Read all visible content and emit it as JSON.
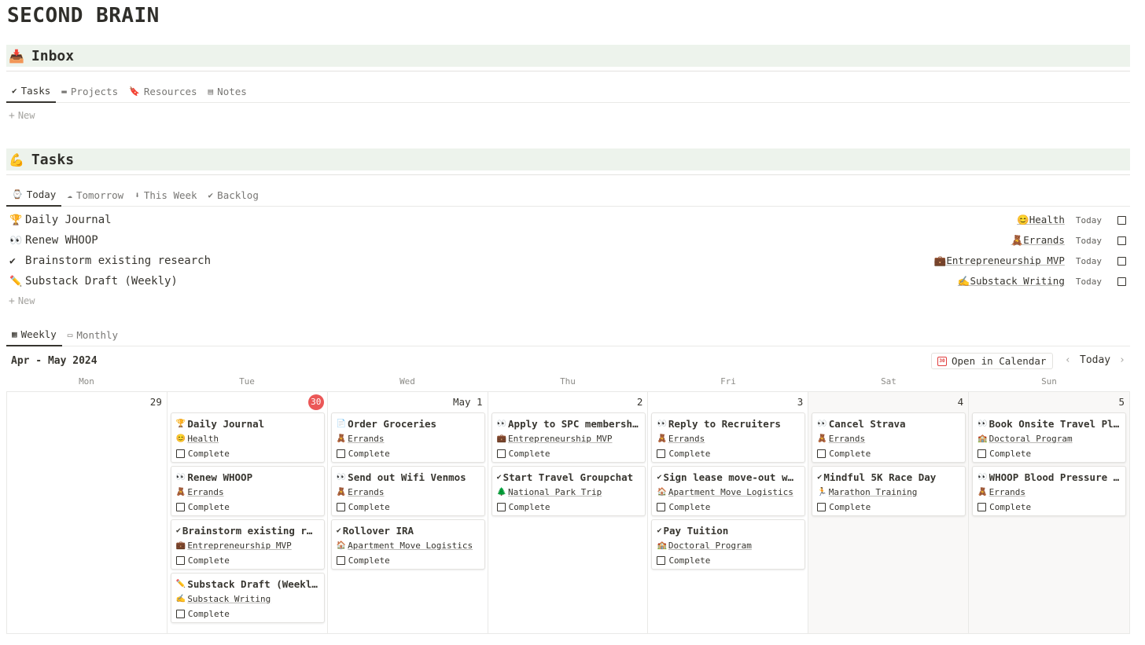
{
  "page": {
    "title": "SECOND BRAIN"
  },
  "inbox": {
    "emoji": "📥",
    "title": "Inbox",
    "tabs": [
      {
        "icon": "✔",
        "label": "Tasks"
      },
      {
        "icon": "▬",
        "label": "Projects"
      },
      {
        "icon": "🔖",
        "label": "Resources"
      },
      {
        "icon": "▤",
        "label": "Notes"
      }
    ],
    "new_label": "New"
  },
  "tasks": {
    "emoji": "💪",
    "title": "Tasks",
    "tabs": [
      {
        "icon": "⌚",
        "label": "Today"
      },
      {
        "icon": "☁",
        "label": "Tomorrow"
      },
      {
        "icon": "⬇",
        "label": "This Week"
      },
      {
        "icon": "✔",
        "label": "Backlog"
      }
    ],
    "rows": [
      {
        "icon": "🏆",
        "name": "Daily Journal",
        "project_icon": "😊",
        "project": "Health",
        "date": "Today"
      },
      {
        "icon": "👀",
        "name": "Renew WHOOP",
        "project_icon": "🧸",
        "project": "Errands",
        "date": "Today"
      },
      {
        "icon": "✔",
        "name": "Brainstorm existing research",
        "project_icon": "💼",
        "project": "Entrepreneurship MVP",
        "date": "Today"
      },
      {
        "icon": "✏️",
        "name": "Substack Draft (Weekly)",
        "project_icon": "✍️",
        "project": "Substack Writing",
        "date": "Today"
      }
    ],
    "new_label": "New"
  },
  "calendar": {
    "tabs": [
      {
        "icon": "▦",
        "label": "Weekly"
      },
      {
        "icon": "▭",
        "label": "Monthly"
      }
    ],
    "range": "Apr - May 2024",
    "open_label": "Open in Calendar",
    "open_icon_text": "30",
    "today_label": "Today",
    "prev_icon": "‹",
    "next_icon": "›",
    "complete_label": "Complete",
    "days": [
      {
        "dow": "Mon",
        "num": "29",
        "today": false,
        "cards": []
      },
      {
        "dow": "Tue",
        "num": "30",
        "today": true,
        "cards": [
          {
            "icon": "🏆",
            "title": "Daily Journal",
            "project_icon": "😊",
            "project": "Health"
          },
          {
            "icon": "👀",
            "title": "Renew WHOOP",
            "project_icon": "🧸",
            "project": "Errands"
          },
          {
            "icon": "✔",
            "title": "Brainstorm existing r…",
            "project_icon": "💼",
            "project": "Entrepreneurship MVP"
          },
          {
            "icon": "✏️",
            "title": "Substack Draft (Weekl…",
            "project_icon": "✍️",
            "project": "Substack Writing"
          }
        ]
      },
      {
        "dow": "Wed",
        "num": "May 1",
        "today": false,
        "cards": [
          {
            "icon": "📄",
            "title": "Order Groceries",
            "project_icon": "🧸",
            "project": "Errands"
          },
          {
            "icon": "👀",
            "title": "Send out Wifi Venmos",
            "project_icon": "🧸",
            "project": "Errands"
          },
          {
            "icon": "✔",
            "title": "Rollover IRA",
            "project_icon": "🏠",
            "project": "Apartment Move Logistics"
          }
        ]
      },
      {
        "dow": "Thu",
        "num": "2",
        "today": false,
        "cards": [
          {
            "icon": "👀",
            "title": "Apply to SPC membersh…",
            "project_icon": "💼",
            "project": "Entrepreneurship MVP"
          },
          {
            "icon": "✔",
            "title": "Start Travel Groupchat",
            "project_icon": "🌲",
            "project": "National Park Trip"
          }
        ]
      },
      {
        "dow": "Fri",
        "num": "3",
        "today": false,
        "cards": [
          {
            "icon": "👀",
            "title": "Reply to Recruiters",
            "project_icon": "🧸",
            "project": "Errands"
          },
          {
            "icon": "✔",
            "title": "Sign lease move-out w…",
            "project_icon": "🏠",
            "project": "Apartment Move Logistics"
          },
          {
            "icon": "✔",
            "title": "Pay Tuition",
            "project_icon": "🏫",
            "project": "Doctoral Program"
          }
        ]
      },
      {
        "dow": "Sat",
        "num": "4",
        "today": false,
        "cards": [
          {
            "icon": "👀",
            "title": "Cancel Strava",
            "project_icon": "🧸",
            "project": "Errands"
          },
          {
            "icon": "✔",
            "title": "Mindful 5K Race Day",
            "project_icon": "🏃",
            "project": "Marathon Training"
          }
        ]
      },
      {
        "dow": "Sun",
        "num": "5",
        "today": false,
        "cards": [
          {
            "icon": "👀",
            "title": "Book Onsite Travel Pl…",
            "project_icon": "🏫",
            "project": "Doctoral Program"
          },
          {
            "icon": "👀",
            "title": "WHOOP Blood Pressure …",
            "project_icon": "🧸",
            "project": "Errands"
          }
        ]
      }
    ]
  },
  "colors": {
    "section_bg": "#edf3ec",
    "today_badge": "#eb5757",
    "weekend_bg": "#f9f8f7",
    "text": "#37352f"
  }
}
